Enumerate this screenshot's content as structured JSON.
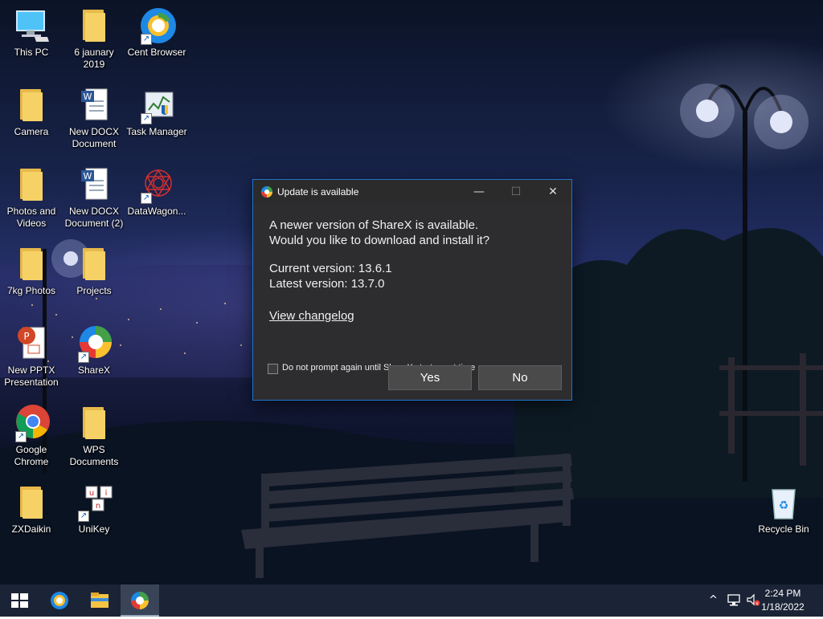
{
  "desktop": {
    "icons": [
      {
        "label": "This PC",
        "icon": "computer-icon"
      },
      {
        "label": "6 jaunary\n2019",
        "icon": "folder-icon"
      },
      {
        "label": "Cent Browser",
        "icon": "cent-browser-icon"
      },
      {
        "label": "Camera",
        "icon": "folder-icon"
      },
      {
        "label": "New DOCX\nDocument",
        "icon": "word-document-icon"
      },
      {
        "label": "Task Manager",
        "icon": "task-manager-icon"
      },
      {
        "label": "Photos and\nVideos",
        "icon": "folder-icon"
      },
      {
        "label": "New DOCX\nDocument (2)",
        "icon": "word-document-icon"
      },
      {
        "label": "DataWagon...",
        "icon": "datawagon-icon"
      },
      {
        "label": "7kg Photos",
        "icon": "folder-icon"
      },
      {
        "label": "Projects",
        "icon": "folder-icon"
      },
      {
        "label": "New PPTX\nPresentation",
        "icon": "powerpoint-icon"
      },
      {
        "label": "ShareX",
        "icon": "sharex-icon"
      },
      {
        "label": "Google\nChrome",
        "icon": "chrome-icon"
      },
      {
        "label": "WPS\nDocuments",
        "icon": "folder-icon"
      },
      {
        "label": "ZXDaikin",
        "icon": "folder-icon"
      },
      {
        "label": "UniKey",
        "icon": "unikey-icon"
      },
      {
        "label": "Recycle Bin",
        "icon": "recycle-bin-icon"
      }
    ]
  },
  "dialog": {
    "title": "Update is available",
    "minimize_glyph": "—",
    "maximize_glyph": "☐",
    "close_glyph": "✕",
    "message_line1": "A newer version of ShareX is available.",
    "message_line2": "Would you like to download and install it?",
    "current_version": "Current version: 13.6.1",
    "latest_version": "Latest version: 13.7.0",
    "changelog_link": "View changelog",
    "checkbox_label": "Do not prompt again until ShareX starts next time",
    "checkbox_checked": false,
    "yes_label": "Yes",
    "no_label": "No",
    "accent_color": "#1f74c8"
  },
  "taskbar": {
    "start_icon": "windows-start-icon",
    "pinned": [
      "cent-browser-icon",
      "file-explorer-icon",
      "sharex-icon"
    ],
    "active_app": "sharex-icon",
    "tray_chevron": "^",
    "time": "2:24 PM",
    "date": "1/18/2022",
    "background": "#1b2436"
  }
}
